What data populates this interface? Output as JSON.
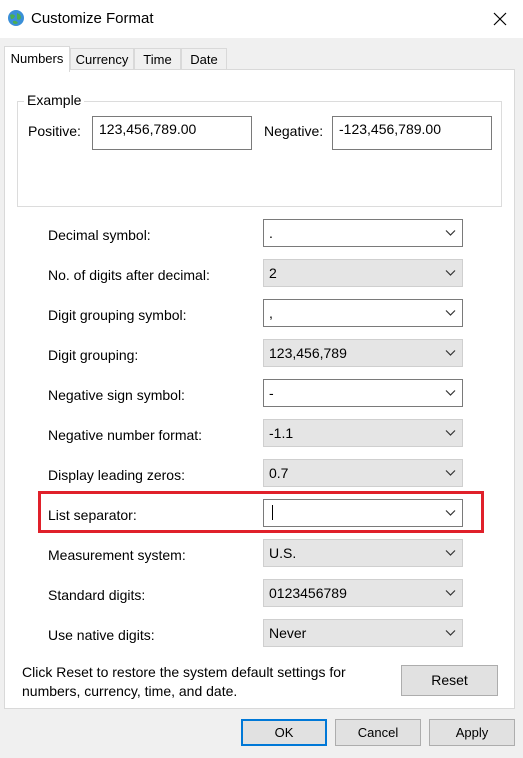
{
  "window": {
    "title": "Customize Format"
  },
  "tabs": [
    {
      "label": "Numbers"
    },
    {
      "label": "Currency"
    },
    {
      "label": "Time"
    },
    {
      "label": "Date"
    }
  ],
  "example": {
    "title": "Example",
    "positive_label": "Positive:",
    "positive_value": "123,456,789.00",
    "negative_label": "Negative:",
    "negative_value": "-123,456,789.00"
  },
  "settings": [
    {
      "label": "Decimal symbol:",
      "value": "."
    },
    {
      "label": "No. of digits after decimal:",
      "value": "2"
    },
    {
      "label": "Digit grouping symbol:",
      "value": ","
    },
    {
      "label": "Digit grouping:",
      "value": "123,456,789"
    },
    {
      "label": "Negative sign symbol:",
      "value": "-"
    },
    {
      "label": "Negative number format:",
      "value": "-1.1"
    },
    {
      "label": "Display leading zeros:",
      "value": "0.7"
    },
    {
      "label": "List separator:",
      "value": ""
    },
    {
      "label": "Measurement system:",
      "value": "U.S."
    },
    {
      "label": "Standard digits:",
      "value": "0123456789"
    },
    {
      "label": "Use native digits:",
      "value": "Never"
    }
  ],
  "reset": {
    "text": "Click Reset to restore the system default settings for numbers, currency, time, and date.",
    "button": "Reset"
  },
  "buttons": {
    "ok": "OK",
    "cancel": "Cancel",
    "apply": "Apply"
  },
  "colors": {
    "highlight": "#e0202a",
    "focus": "#0078d7"
  }
}
